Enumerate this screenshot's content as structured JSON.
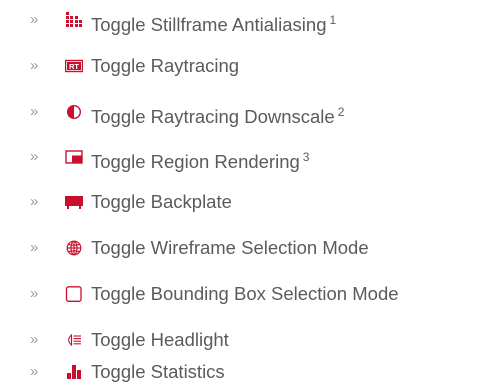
{
  "bullet": "»",
  "accent": "#c8102e",
  "text_color": "#5b5b5b",
  "items": [
    {
      "label": "Toggle Stillframe Antialiasing",
      "note": "1",
      "icon": "antialiasing-grid-icon"
    },
    {
      "label": "Toggle Raytracing",
      "note": "",
      "icon": "raytracing-rt-icon",
      "icon_text": "RT"
    },
    {
      "label": "Toggle Raytracing Downscale",
      "note": "2",
      "icon": "half-circle-icon"
    },
    {
      "label": "Toggle Region Rendering",
      "note": "3",
      "icon": "region-rendering-icon"
    },
    {
      "label": "Toggle Backplate",
      "note": "",
      "icon": "backplate-icon"
    },
    {
      "label": "Toggle Wireframe Selection Mode",
      "note": "",
      "icon": "wireframe-globe-icon"
    },
    {
      "label": "Toggle Bounding Box Selection Mode",
      "note": "",
      "icon": "bounding-box-icon"
    },
    {
      "label": "Toggle Headlight",
      "note": "",
      "icon": "headlight-icon"
    },
    {
      "label": "Toggle Statistics",
      "note": "",
      "icon": "statistics-bars-icon"
    }
  ]
}
